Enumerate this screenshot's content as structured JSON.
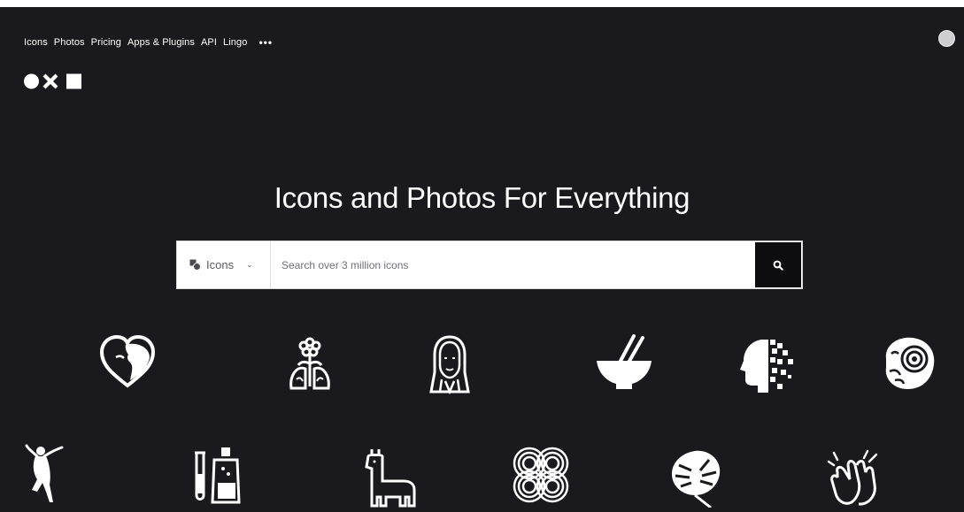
{
  "nav": {
    "items": [
      "Icons",
      "Photos",
      "Pricing",
      "Apps & Plugins",
      "API",
      "Lingo"
    ],
    "more": "•••"
  },
  "hero": {
    "headline": "Icons and Photos For Everything"
  },
  "search": {
    "type_label": "Icons",
    "placeholder": "Search over 3 million icons"
  },
  "icons_row1": [
    "heart-face-icon",
    "lungs-flower-icon",
    "woman-portrait-icon",
    "bowl-chopsticks-icon",
    "pixel-head-icon",
    "ammonite-fossil-icon"
  ],
  "icons_row2": [
    "dancer-icon",
    "test-tube-bottle-icon",
    "llama-icon",
    "interlocking-spirals-icon",
    "monstera-leaf-icon",
    "clapping-hands-icon"
  ],
  "colors": {
    "background": "#1a191d",
    "foreground": "#ffffff",
    "search_button": "#0d0d0f"
  }
}
